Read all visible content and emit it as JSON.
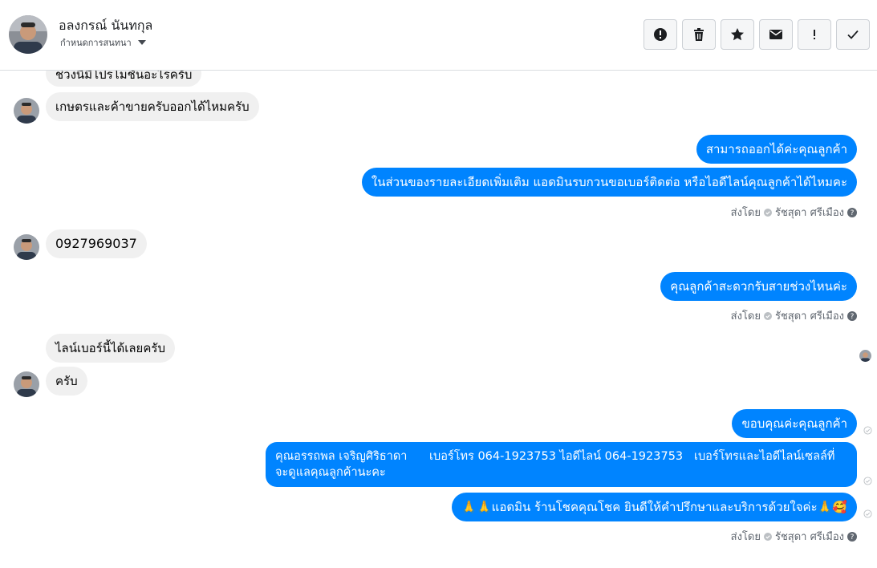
{
  "header": {
    "contact_name": "อลงกรณ์ นันทกุล",
    "subtitle": "กำหนดการสนทนา",
    "avatar_icon": "profile-photo",
    "toolbar": [
      {
        "icon": "alert-circle-icon",
        "tooltip": ""
      },
      {
        "icon": "trash-icon",
        "tooltip": ""
      },
      {
        "icon": "star-icon",
        "tooltip": ""
      },
      {
        "icon": "envelope-icon",
        "tooltip": ""
      },
      {
        "icon": "exclamation-icon",
        "tooltip": ""
      },
      {
        "icon": "check-icon",
        "tooltip": ""
      }
    ]
  },
  "messages": {
    "m0": "ช่วงนี้มีโปรโมชั่นอะไรครับ",
    "m1": "เกษตรและค้าขายครับออกได้ไหมครับ",
    "m2": "สามารถออกได้ค่ะคุณลูกค้า",
    "m3": "ในส่วนของรายละเอียดเพิ่มเติม แอดมินรบกวนขอเบอร์ติดต่อ หรือไอดีไลน์คุณลูกค้าได้ไหมคะ",
    "m4": "0927969037",
    "m5": "คุณลูกค้าสะดวกรับสายช่วงไหนค่ะ",
    "m6": "ไลน์เบอร์นี้ได้เลยครับ",
    "m7": "ครับ",
    "m8": "ขอบคุณค่ะคุณลูกค้า",
    "m9_line1": "คุณอรรถพล เจริญศิริธาดา      เบอร์โทร 064-1923753 ไอดีไลน์ 064-1923753   เบอร์โทรและไอดีไลน์เซลล์ที่",
    "m9_line2": "จะดูแลคุณลูกค้านะคะ",
    "m10": "🙏🙏แอดมิน ร้านโชคคุณโชค ยินดีให้คำปรึกษาและบริการด้วยใจค่ะ🙏🥰"
  },
  "sent_by": {
    "label": "ส่งโดย",
    "agent": "รัชสุดา ศรีเมือง"
  },
  "colors": {
    "outgoing": "#0084ff",
    "incoming": "#f0f0f0",
    "muted": "#606770"
  }
}
